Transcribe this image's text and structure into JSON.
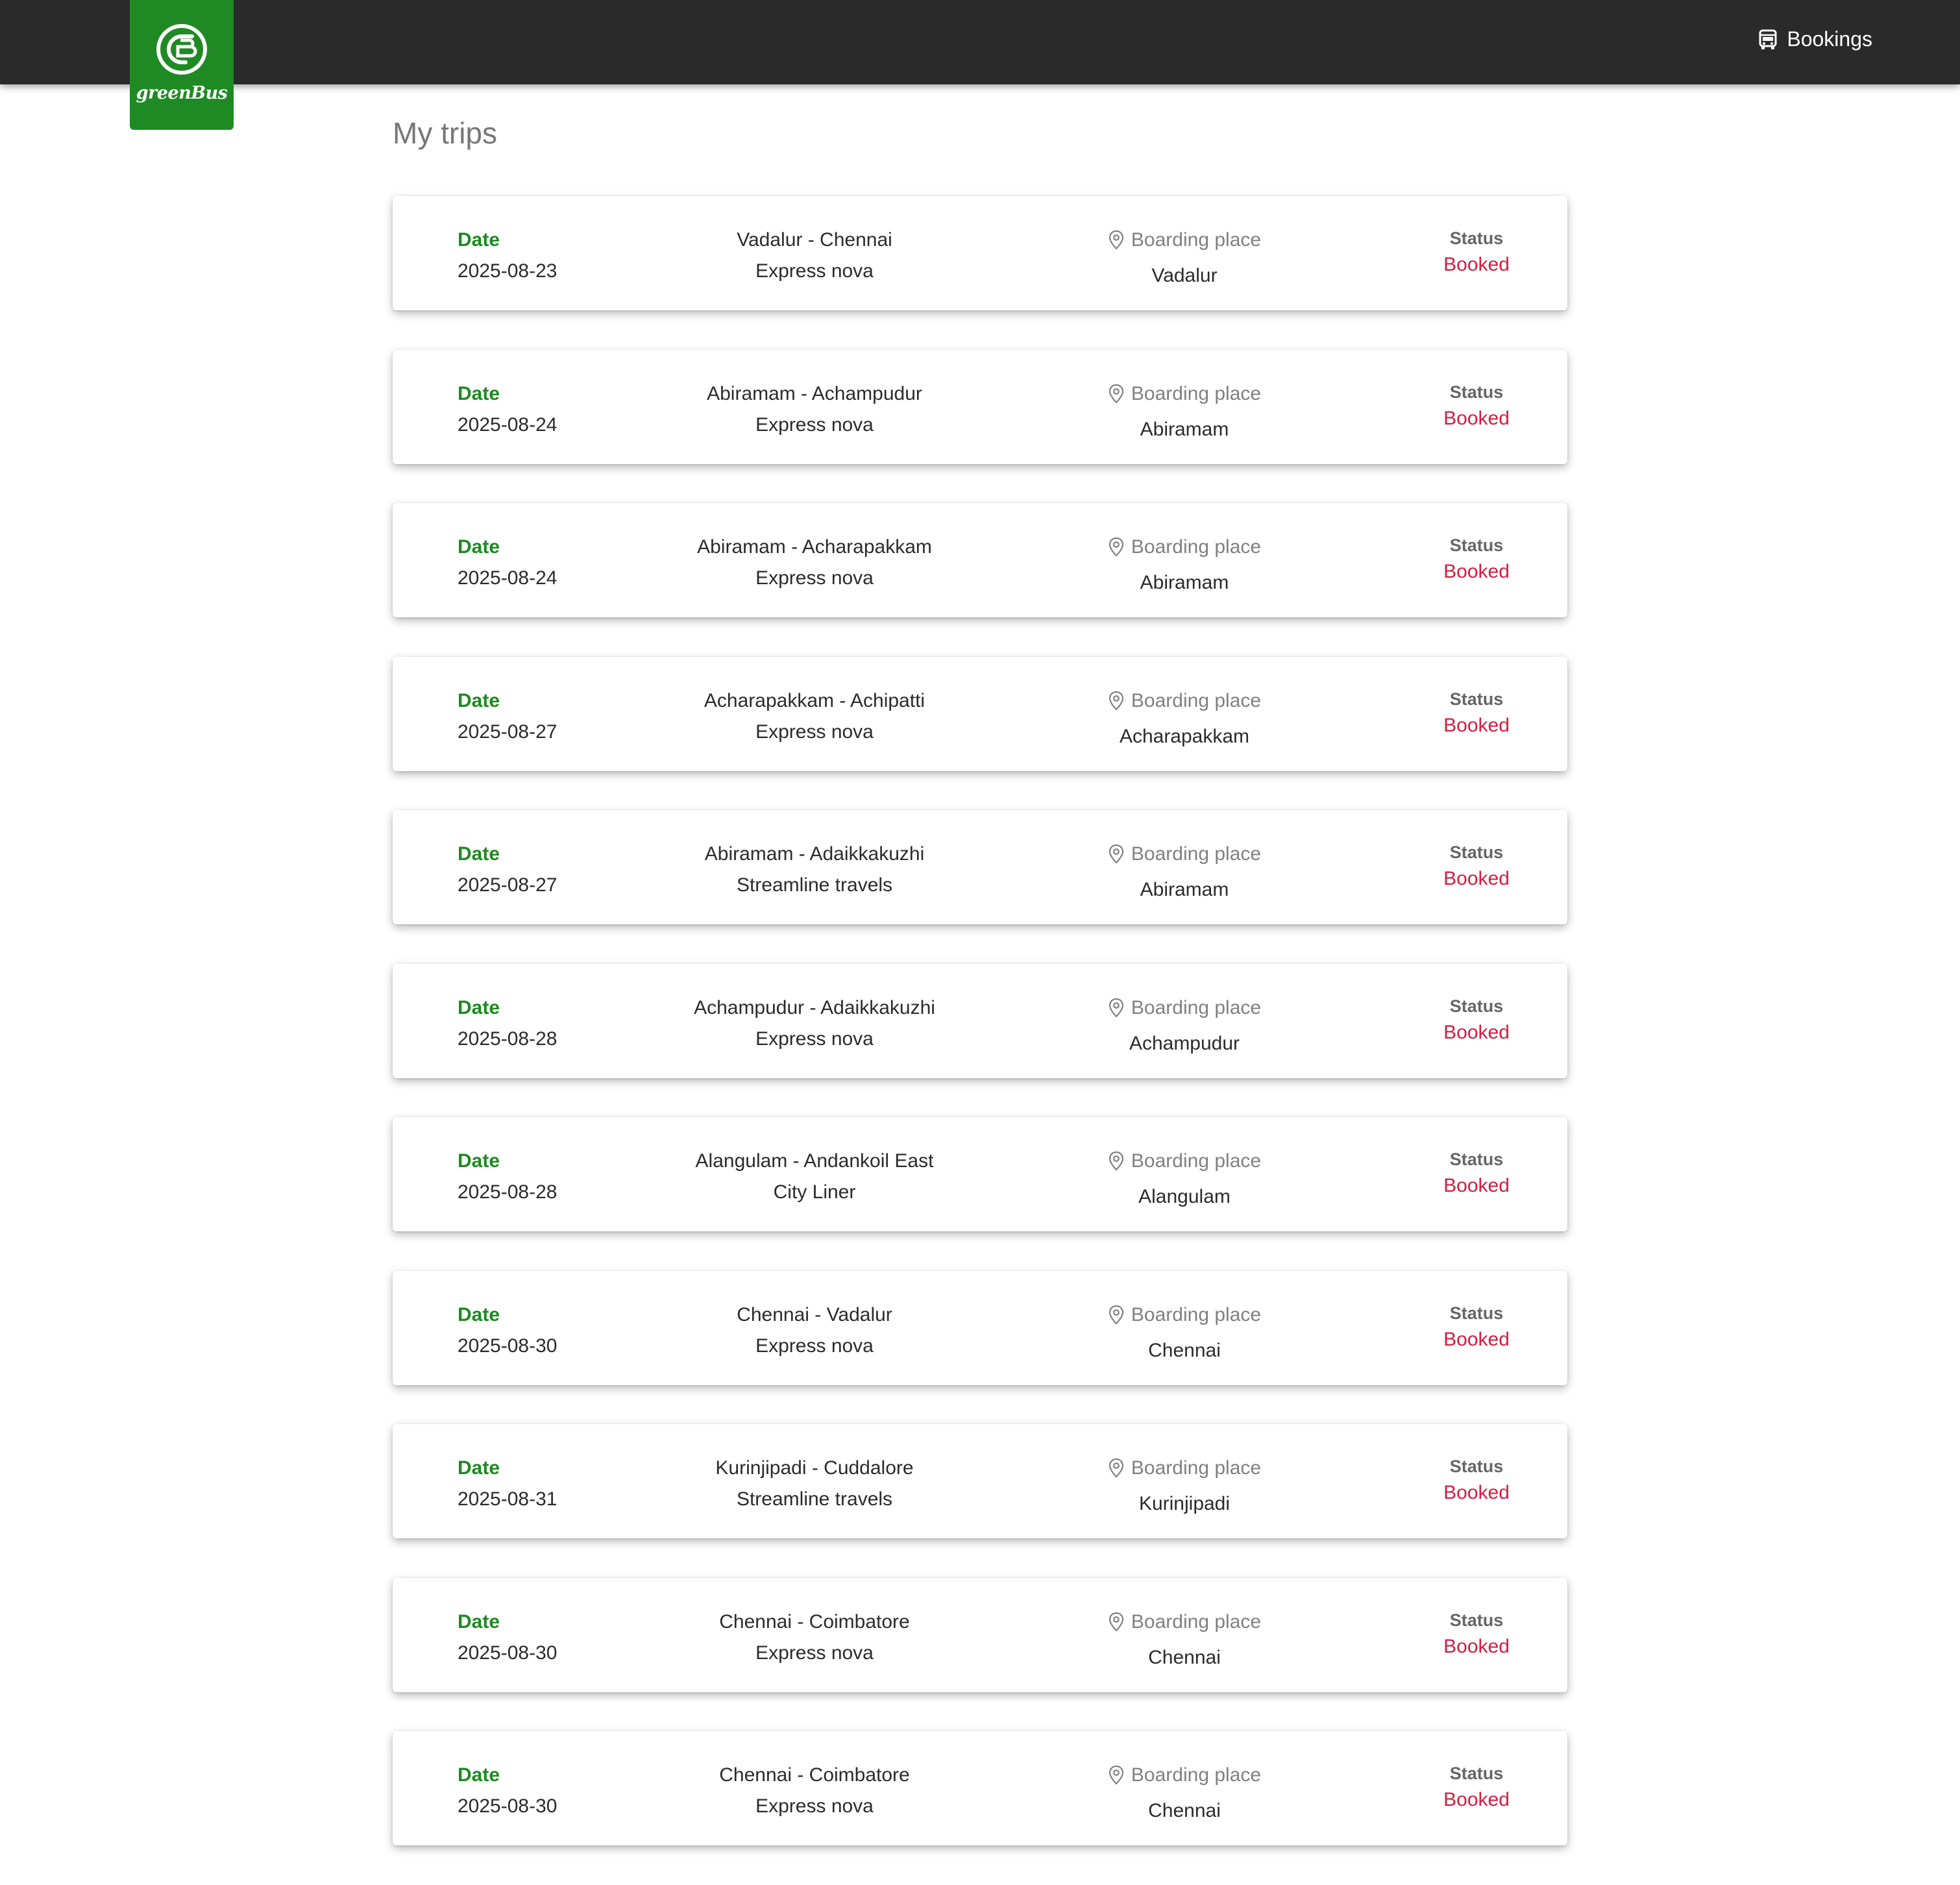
{
  "header": {
    "brand": "greenBus",
    "logo_mark": "GB",
    "nav_bookings_label": "Bookings",
    "brand_color": "#1f8a24",
    "bar_color": "#2a2a2a"
  },
  "page": {
    "title": "My trips"
  },
  "labels": {
    "date": "Date",
    "boarding": "Boarding place",
    "status": "Status"
  },
  "colors": {
    "date_label": "#1e8a22",
    "status_booked": "#d81b40"
  },
  "trips": [
    {
      "date": "2025-08-23",
      "route": "Vadalur - Chennai",
      "operator": "Express nova",
      "boarding": "Vadalur",
      "status": "Booked"
    },
    {
      "date": "2025-08-24",
      "route": "Abiramam - Achampudur",
      "operator": "Express nova",
      "boarding": "Abiramam",
      "status": "Booked"
    },
    {
      "date": "2025-08-24",
      "route": "Abiramam - Acharapakkam",
      "operator": "Express nova",
      "boarding": "Abiramam",
      "status": "Booked"
    },
    {
      "date": "2025-08-27",
      "route": "Acharapakkam - Achipatti",
      "operator": "Express nova",
      "boarding": "Acharapakkam",
      "status": "Booked"
    },
    {
      "date": "2025-08-27",
      "route": "Abiramam - Adaikkakuzhi",
      "operator": "Streamline travels",
      "boarding": "Abiramam",
      "status": "Booked"
    },
    {
      "date": "2025-08-28",
      "route": "Achampudur - Adaikkakuzhi",
      "operator": "Express nova",
      "boarding": "Achampudur",
      "status": "Booked"
    },
    {
      "date": "2025-08-28",
      "route": "Alangulam - Andankoil East",
      "operator": "City Liner",
      "boarding": "Alangulam",
      "status": "Booked"
    },
    {
      "date": "2025-08-30",
      "route": "Chennai - Vadalur",
      "operator": "Express nova",
      "boarding": "Chennai",
      "status": "Booked"
    },
    {
      "date": "2025-08-31",
      "route": "Kurinjipadi - Cuddalore",
      "operator": "Streamline travels",
      "boarding": "Kurinjipadi",
      "status": "Booked"
    },
    {
      "date": "2025-08-30",
      "route": "Chennai - Coimbatore",
      "operator": "Express nova",
      "boarding": "Chennai",
      "status": "Booked"
    },
    {
      "date": "2025-08-30",
      "route": "Chennai - Coimbatore",
      "operator": "Express nova",
      "boarding": "Chennai",
      "status": "Booked"
    }
  ]
}
